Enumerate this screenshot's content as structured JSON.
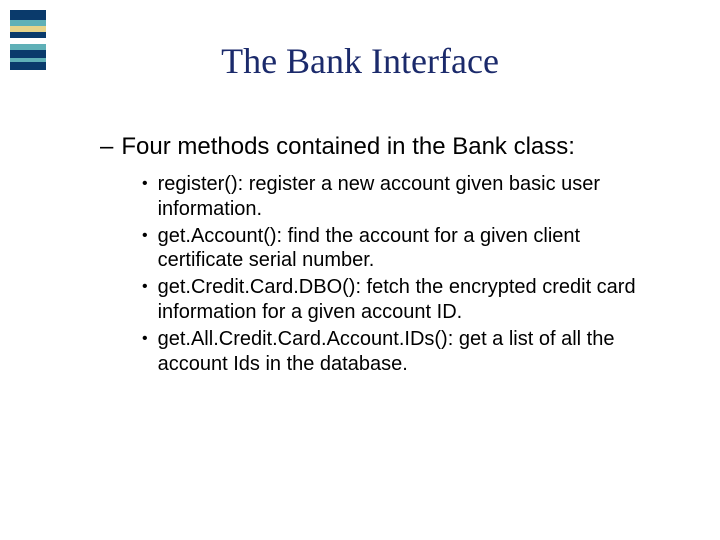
{
  "stripes": [
    {
      "color": "#0a3a6b",
      "h": 10
    },
    {
      "color": "#5fb0b7",
      "h": 6
    },
    {
      "color": "#e6d38a",
      "h": 6
    },
    {
      "color": "#0a3a6b",
      "h": 6
    },
    {
      "color": "#ffffff",
      "h": 6
    },
    {
      "color": "#5fb0b7",
      "h": 6
    },
    {
      "color": "#0a3a6b",
      "h": 8
    },
    {
      "color": "#5fb0b7",
      "h": 4
    },
    {
      "color": "#0a3a6b",
      "h": 8
    }
  ],
  "title": "The Bank Interface",
  "body": {
    "level1": {
      "dash": "–",
      "text": "Four methods contained in the Bank class:"
    },
    "items": [
      {
        "bullet": "•",
        "text": "register(): register a new account given basic user information."
      },
      {
        "bullet": "•",
        "text": "get.Account(): find the account for a given client certificate serial number."
      },
      {
        "bullet": "•",
        "text": "get.Credit.Card.DBO(): fetch the encrypted credit card information for a given account ID."
      },
      {
        "bullet": "•",
        "text": "get.All.Credit.Card.Account.IDs(): get a list of all the account Ids in the database."
      }
    ]
  }
}
